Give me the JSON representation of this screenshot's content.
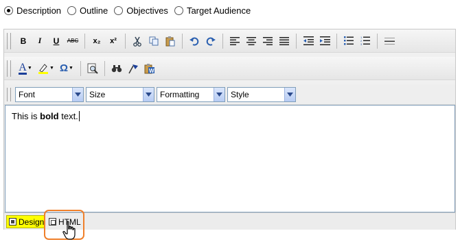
{
  "view_options": [
    {
      "label": "Description",
      "checked": true
    },
    {
      "label": "Outline",
      "checked": false
    },
    {
      "label": "Objectives",
      "checked": false
    },
    {
      "label": "Target Audience",
      "checked": false
    }
  ],
  "toolbar1": {
    "bold": "B",
    "italic": "I",
    "underline": "U",
    "strike": "ABC",
    "subscript": "x₂",
    "superscript": "x²"
  },
  "toolbar2": {
    "font_color": "A",
    "special_char": "Ω"
  },
  "dropdowns": {
    "font": "Font",
    "size": "Size",
    "formatting": "Formatting",
    "style": "Style"
  },
  "content": {
    "pre": "This is ",
    "bold": "bold",
    "post": " text."
  },
  "tabs": {
    "design": "Design",
    "html": "HTML"
  },
  "colors": {
    "design_tab_bg": "#ffff00",
    "highlight_border": "#ef7f2a",
    "select_border": "#7f9db9"
  }
}
